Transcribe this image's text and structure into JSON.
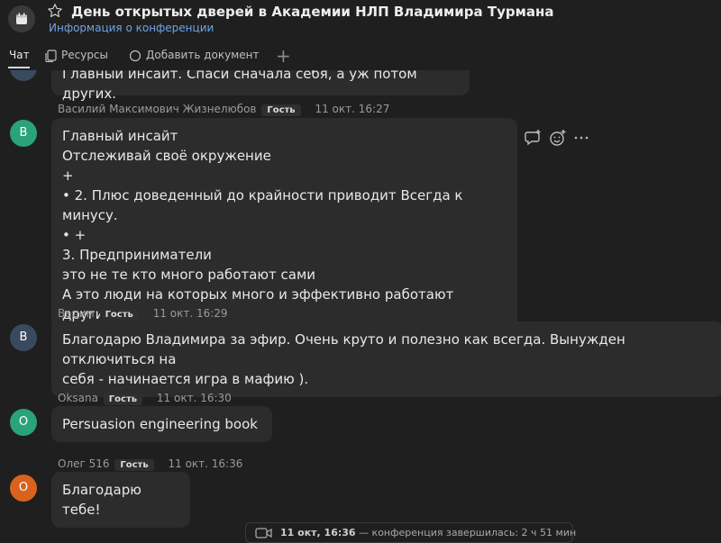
{
  "header": {
    "title": "День открытых дверей в Академии НЛП Владимира Турмана",
    "subtitle": "Информация о конференции"
  },
  "tabs": [
    {
      "label": "Чат"
    },
    {
      "label": "Ресурсы"
    },
    {
      "label": "Добавить документ"
    }
  ],
  "messages": [
    {
      "avatar_letter": "",
      "avatar_color": "#3a4a5e",
      "author": "",
      "badge": "",
      "time": "",
      "lines": [
        "Главный инсайт. Спаси сначала себя, а уж потом других."
      ]
    },
    {
      "avatar_letter": "В",
      "avatar_color": "#2aa37a",
      "author": "Василий Максимович Жизнелюбов",
      "badge": "Гость",
      "time": "11 окт. 16:27",
      "lines": [
        "Главный инсайт",
        "Отслеживай своё окружение",
        "+",
        "•  2. Плюс доведенный до крайности приводит Всегда к минусу.",
        "•  +",
        "3.  Предприниматели",
        "это не те кто много работают сами",
        "А это люди на которых много и эффективно работают другие."
      ]
    },
    {
      "avatar_letter": "В",
      "avatar_color": "#3a4a5e",
      "author": "Вадим",
      "badge": "Гость",
      "time": "11 окт. 16:29",
      "lines": [
        "Благодарю Владимира за эфир. Очень круто и полезно как всегда. Вынужден отключиться на",
        "себя - начинается игра в мафию )."
      ]
    },
    {
      "avatar_letter": "O",
      "avatar_color": "#2aa37a",
      "author": "Oksana",
      "badge": "Гость",
      "time": "11 окт. 16:30",
      "lines": [
        "Persuasion engineering book"
      ]
    },
    {
      "avatar_letter": "О",
      "avatar_color": "#d9621e",
      "author": "Олег 516",
      "badge": "Гость",
      "time": "11 окт. 16:36",
      "lines": [
        "Благодарю тебе!"
      ]
    }
  ],
  "system_message": {
    "time": "11 окт, 16:36",
    "text": "— конференция завершилась: 2 ч 51 мин"
  },
  "icons": {
    "app": "calendar-icon",
    "favorite": "star-icon",
    "resources": "files-icon",
    "add_document": "add-document-icon",
    "add_tab": "plus-icon",
    "reply": "reply-icon",
    "reaction": "emoji-icon",
    "more": "more-icon",
    "call": "camera-icon"
  }
}
